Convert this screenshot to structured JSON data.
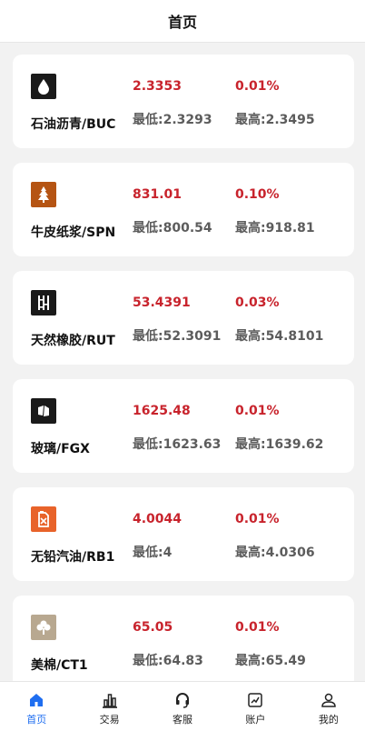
{
  "header": {
    "title": "首页"
  },
  "colors": {
    "up": "#c8232c",
    "muted": "#5c5c5c",
    "accent": "#1f6ef0"
  },
  "items": [
    {
      "icon": "oil-drop-icon",
      "icon_bg": "#1a1a1a",
      "name": "石油沥青/BUC",
      "price": "2.3353",
      "change": "0.01%",
      "low": "最低:2.3293",
      "high": "最高:2.3495"
    },
    {
      "icon": "tree-icon",
      "icon_bg": "#b55413",
      "name": "牛皮纸浆/SPN",
      "price": "831.01",
      "change": "0.10%",
      "low": "最低:800.54",
      "high": "最高:918.81"
    },
    {
      "icon": "rubber-icon",
      "icon_bg": "#1a1a1a",
      "name": "天然橡胶/RUT",
      "price": "53.4391",
      "change": "0.03%",
      "low": "最低:52.3091",
      "high": "最高:54.8101"
    },
    {
      "icon": "glass-icon",
      "icon_bg": "#1a1a1a",
      "name": "玻璃/FGX",
      "price": "1625.48",
      "change": "0.01%",
      "low": "最低:1623.63",
      "high": "最高:1639.62"
    },
    {
      "icon": "fuel-can-icon",
      "icon_bg": "#e8632a",
      "name": "无铅汽油/RB1",
      "price": "4.0044",
      "change": "0.01%",
      "low": "最低:4",
      "high": "最高:4.0306"
    },
    {
      "icon": "cotton-icon",
      "icon_bg": "#b8a890",
      "name": "美棉/CT1",
      "price": "65.05",
      "change": "0.01%",
      "low": "最低:64.83",
      "high": "最高:65.49"
    }
  ],
  "tabs": [
    {
      "label": "首页",
      "icon": "home-icon",
      "active": true
    },
    {
      "label": "交易",
      "icon": "bar-chart-icon",
      "active": false
    },
    {
      "label": "客服",
      "icon": "headset-icon",
      "active": false
    },
    {
      "label": "账户",
      "icon": "account-chart-icon",
      "active": false
    },
    {
      "label": "我的",
      "icon": "user-icon",
      "active": false
    }
  ]
}
